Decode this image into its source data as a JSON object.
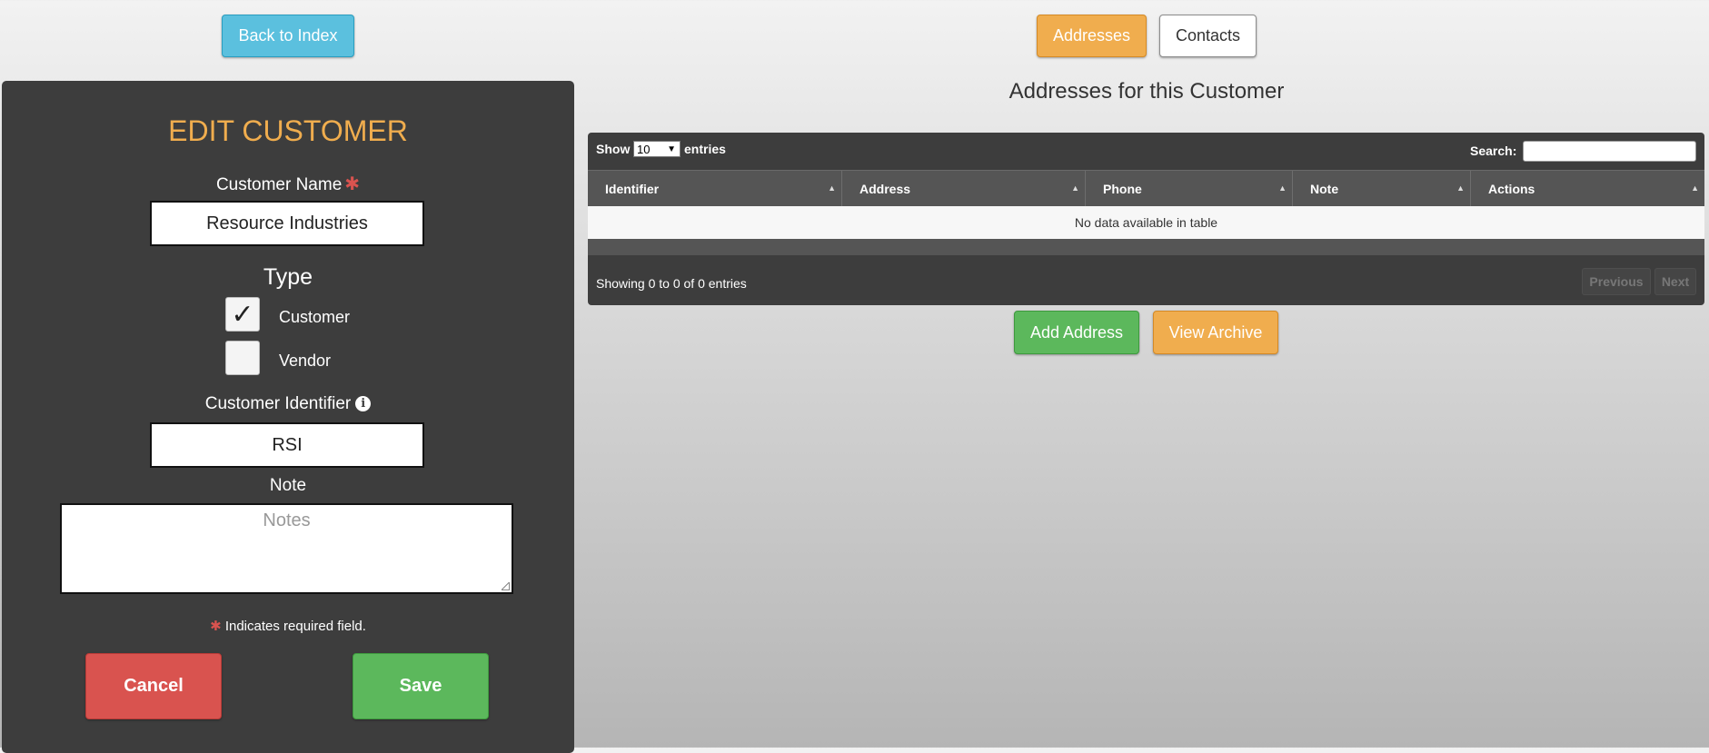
{
  "top_nav": {
    "back_label": "Back to Index",
    "addresses_label": "Addresses",
    "contacts_label": "Contacts"
  },
  "edit_form": {
    "title": "EDIT CUSTOMER",
    "customer_name_label": "Customer Name",
    "customer_name_value": "Resource Industries",
    "required_star": "✱",
    "type_label": "Type",
    "types": [
      {
        "label": "Customer",
        "checked": true,
        "mark": "✓"
      },
      {
        "label": "Vendor",
        "checked": false,
        "mark": ""
      }
    ],
    "identifier_label": "Customer Identifier",
    "identifier_info_icon": "i",
    "identifier_value": "RSI",
    "note_label": "Note",
    "note_placeholder": "Notes",
    "required_note": "Indicates required field.",
    "cancel_label": "Cancel",
    "save_label": "Save"
  },
  "addresses": {
    "section_title": "Addresses for this Customer",
    "show_label": "Show",
    "page_length": "10",
    "entries_label": "entries",
    "search_label": "Search:",
    "columns": [
      "Identifier",
      "Address",
      "Phone",
      "Note",
      "Actions"
    ],
    "empty_message": "No data available in table",
    "info": "Showing 0 to 0 of 0 entries",
    "previous_label": "Previous",
    "next_label": "Next",
    "add_label": "Add Address",
    "archive_label": "View Archive"
  },
  "colors": {
    "accent_orange": "#f0ad4e",
    "panel_dark": "#3d3d3d",
    "success_green": "#5cb85c",
    "danger_red": "#d9534f",
    "info_blue": "#5bc0de"
  },
  "icons": {
    "required": "asterisk-icon",
    "info": "info-circle-icon",
    "sort": "sort-icon",
    "check": "check-icon"
  }
}
